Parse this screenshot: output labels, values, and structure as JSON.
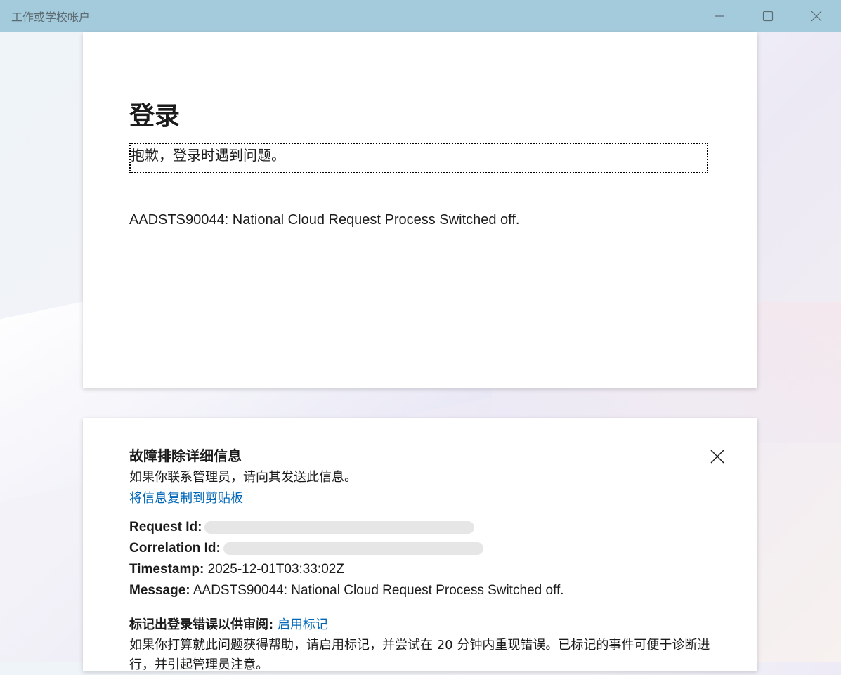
{
  "window": {
    "title": "工作或学校帐户"
  },
  "signin": {
    "heading": "登录",
    "subtitle": "抱歉，登录时遇到问题。",
    "error_message": "AADSTS90044: National Cloud Request Process Switched off."
  },
  "troubleshooting": {
    "title": "故障排除详细信息",
    "description": "如果你联系管理员，请向其发送此信息。",
    "copy_link": "将信息复制到剪贴板",
    "request_id_label": "Request Id:",
    "correlation_id_label": "Correlation Id:",
    "timestamp_label": "Timestamp:",
    "timestamp_value": "2025-12-01T03:33:02Z",
    "message_label": "Message:",
    "message_value": "AADSTS90044: National Cloud Request Process Switched off.",
    "flag_label": "标记出登录错误以供审阅:",
    "flag_link": "启用标记",
    "flag_description": "如果你打算就此问题获得帮助，请启用标记，并尝试在 20 分钟内重现错误。已标记的事件可便于诊断进行，并引起管理员注意。"
  },
  "colors": {
    "titlebar": "#a4cbdc",
    "link": "#0067b8"
  }
}
